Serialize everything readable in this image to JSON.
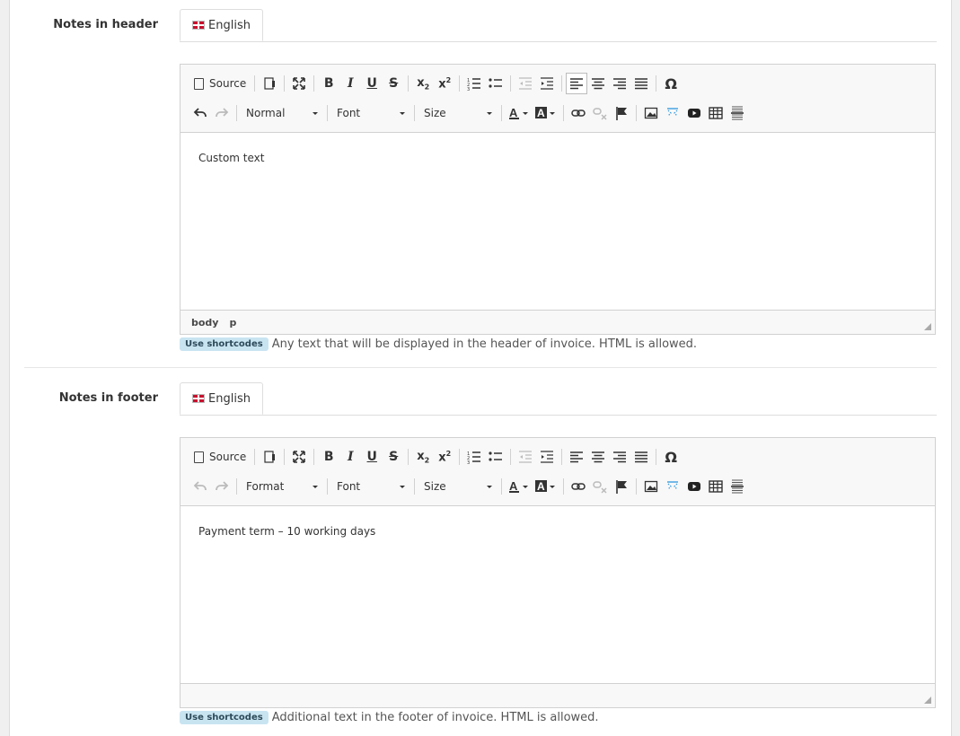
{
  "header_section": {
    "label": "Notes in header",
    "tab_label": "English",
    "format_combo": "Normal",
    "font_combo": "Font",
    "size_combo": "Size",
    "source_label": "Source",
    "content_text": "Custom text",
    "path": [
      "body",
      "p"
    ],
    "shortcode_badge": "Use shortcodes",
    "help_text": "Any text that will be displayed in the header of invoice. HTML is allowed."
  },
  "footer_section": {
    "label": "Notes in footer",
    "tab_label": "English",
    "format_combo": "Format",
    "font_combo": "Font",
    "size_combo": "Size",
    "source_label": "Source",
    "content_text": "Payment term – 10 working days",
    "shortcode_badge": "Use shortcodes",
    "help_text": "Additional text in the footer of invoice. HTML is allowed."
  },
  "colors": {
    "accent": "#c8e4f1",
    "toolbar_bg": "#f8f8f8",
    "border": "#d1d1d1"
  }
}
